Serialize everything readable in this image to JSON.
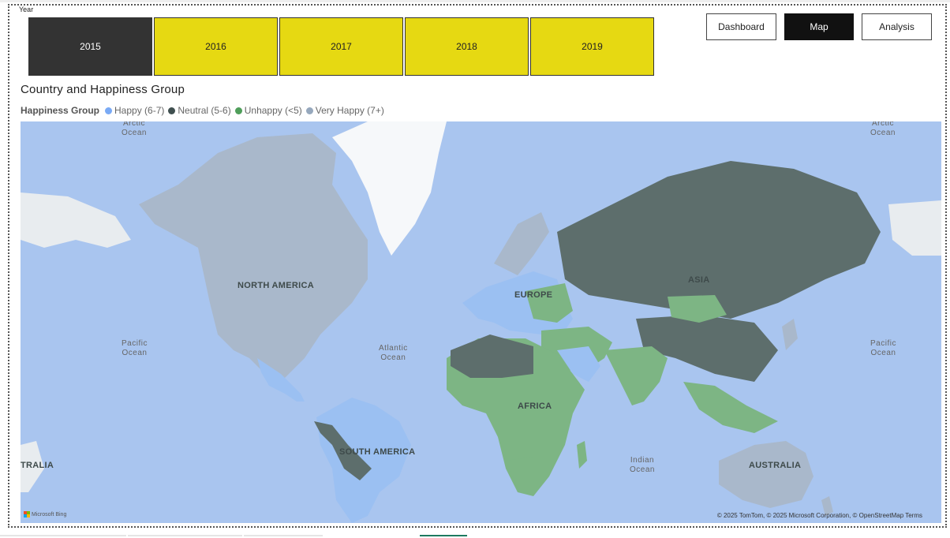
{
  "slicer": {
    "label": "Year",
    "options": [
      "2015",
      "2016",
      "2017",
      "2018",
      "2019"
    ],
    "selected": "2015"
  },
  "nav": {
    "dashboard": "Dashboard",
    "map": "Map",
    "analysis": "Analysis",
    "active": "Map"
  },
  "map": {
    "title": "Country and Happiness Group",
    "legend_title": "Happiness Group",
    "legend": [
      {
        "label": "Happy (6-7)",
        "color": "#7aaaf5"
      },
      {
        "label": "Neutral (5-6)",
        "color": "#3f4f4f"
      },
      {
        "label": "Unhappy (<5)",
        "color": "#4f9e5a"
      },
      {
        "label": "Very Happy (7+)",
        "color": "#96a8bd"
      }
    ],
    "labels": {
      "arctic_left": "Arctic\nOcean",
      "arctic_right": "Arctic\nOcean",
      "pacific_left": "Pacific\nOcean",
      "pacific_right": "Pacific\nOcean",
      "atlantic": "Atlantic\nOcean",
      "indian": "Indian\nOcean",
      "north_america": "NORTH AMERICA",
      "south_america": "SOUTH AMERICA",
      "europe": "EUROPE",
      "africa": "AFRICA",
      "asia": "ASIA",
      "australia": "AUSTRALIA",
      "australia_left": "TRALIA"
    },
    "provider": "Microsoft Bing",
    "attribution": "© 2025 TomTom, © 2025 Microsoft Corporation, © OpenStreetMap  Terms",
    "colors": {
      "ocean": "#a9c5ef",
      "very_happy": "#a9b8cb",
      "happy": "#9bc0f2",
      "neutral": "#5d6e6c",
      "unhappy": "#7db584",
      "unknown": "#e8ecef"
    }
  }
}
